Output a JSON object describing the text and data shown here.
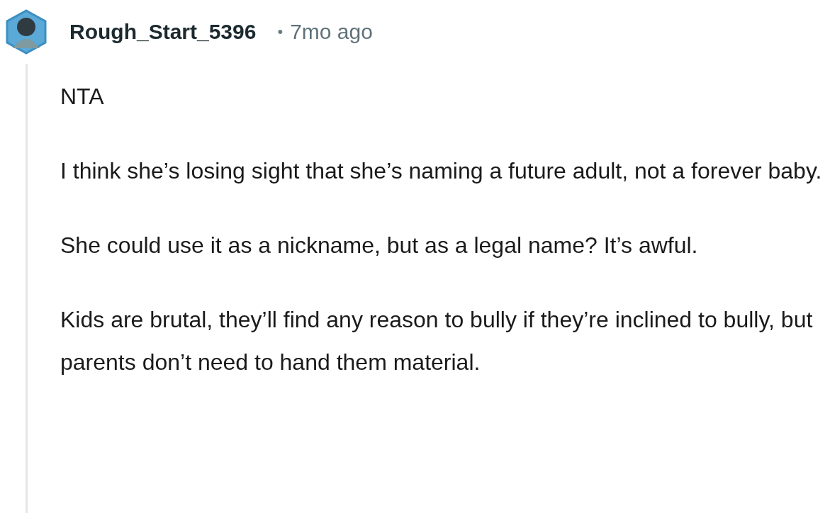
{
  "comment": {
    "username": "Rough_Start_5396",
    "separator": "•",
    "time": "7mo ago",
    "paragraphs": [
      "NTA",
      "I think she’s losing sight that she’s naming a future adult, not a forever baby.",
      "She could use it as a nickname, but as a legal name? It’s awful.",
      "Kids are brutal, they’ll find any reason to bully if they’re inclined to bully, but parents don’t need to hand them material."
    ]
  }
}
